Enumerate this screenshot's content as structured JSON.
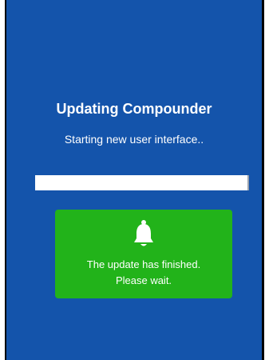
{
  "update": {
    "title": "Updating Compounder",
    "subtitle": "Starting new user interface..",
    "progress_fraction": 1.0
  },
  "notice": {
    "icon": "bell-icon",
    "line1": "The update has finished.",
    "line2": "Please wait."
  },
  "colors": {
    "background": "#1454ab",
    "notice_background": "#22b31a",
    "progress": "#ffffff"
  }
}
